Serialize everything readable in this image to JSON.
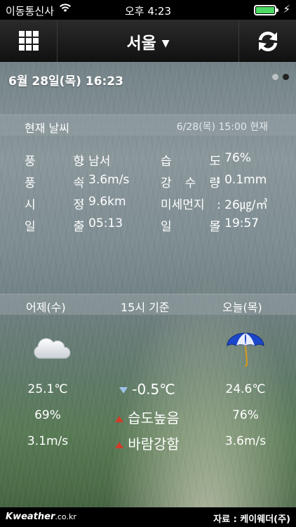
{
  "status_bar": {
    "carrier": "이동통신사",
    "time": "오후 4:23",
    "wifi_icon": "wifi-icon",
    "battery_icon": "battery-icon",
    "charging_icon": "lightning-icon"
  },
  "nav": {
    "city": "서울",
    "menu_icon": "grid-icon",
    "refresh_icon": "refresh-icon"
  },
  "date_time": "6월 28일(목) 16:23",
  "pager": {
    "page_count": 2,
    "active_index": 1
  },
  "current": {
    "title": "현재 날씨",
    "observed": "6/28(목) 15:00 현재",
    "rows": [
      {
        "l1": [
          "풍",
          "향"
        ],
        "v1": ": 남서",
        "l2": [
          "습",
          "도"
        ],
        "v2": ": 76%"
      },
      {
        "l1": [
          "풍",
          "속"
        ],
        "v1": ": 3.6m/s",
        "l2": [
          "강",
          "수",
          "량"
        ],
        "v2": ": 0.1mm"
      },
      {
        "l1": [
          "시",
          "정"
        ],
        "v1": ": 9.6km",
        "l2": [
          "미세먼지"
        ],
        "v2": ": 26㎍/㎥"
      },
      {
        "l1": [
          "일",
          "출"
        ],
        "v1": ": 05:13",
        "l2": [
          "일",
          "몰"
        ],
        "v2": ": 19:57"
      }
    ]
  },
  "compare": {
    "yesterday_label": "어제(수)",
    "basis_label": "15시 기준",
    "today_label": "오늘(목)",
    "yesterday_icon": "cloud-icon",
    "today_icon": "umbrella-icon",
    "yesterday_temp": "25.1℃",
    "today_temp": "24.6℃",
    "temp_diff": "-0.5℃",
    "yesterday_humidity": "69%",
    "today_humidity": "76%",
    "humidity_note": "습도높음",
    "yesterday_wind": "3.1m/s",
    "today_wind": "3.6m/s",
    "wind_note": "바람강함",
    "colors": {
      "down": "#9fc3ea",
      "up": "#d23b28"
    }
  },
  "footer": {
    "logo_brand": "Kweather",
    "logo_domain": ".co.kr",
    "source": "자료 : 케이웨더(주)"
  }
}
